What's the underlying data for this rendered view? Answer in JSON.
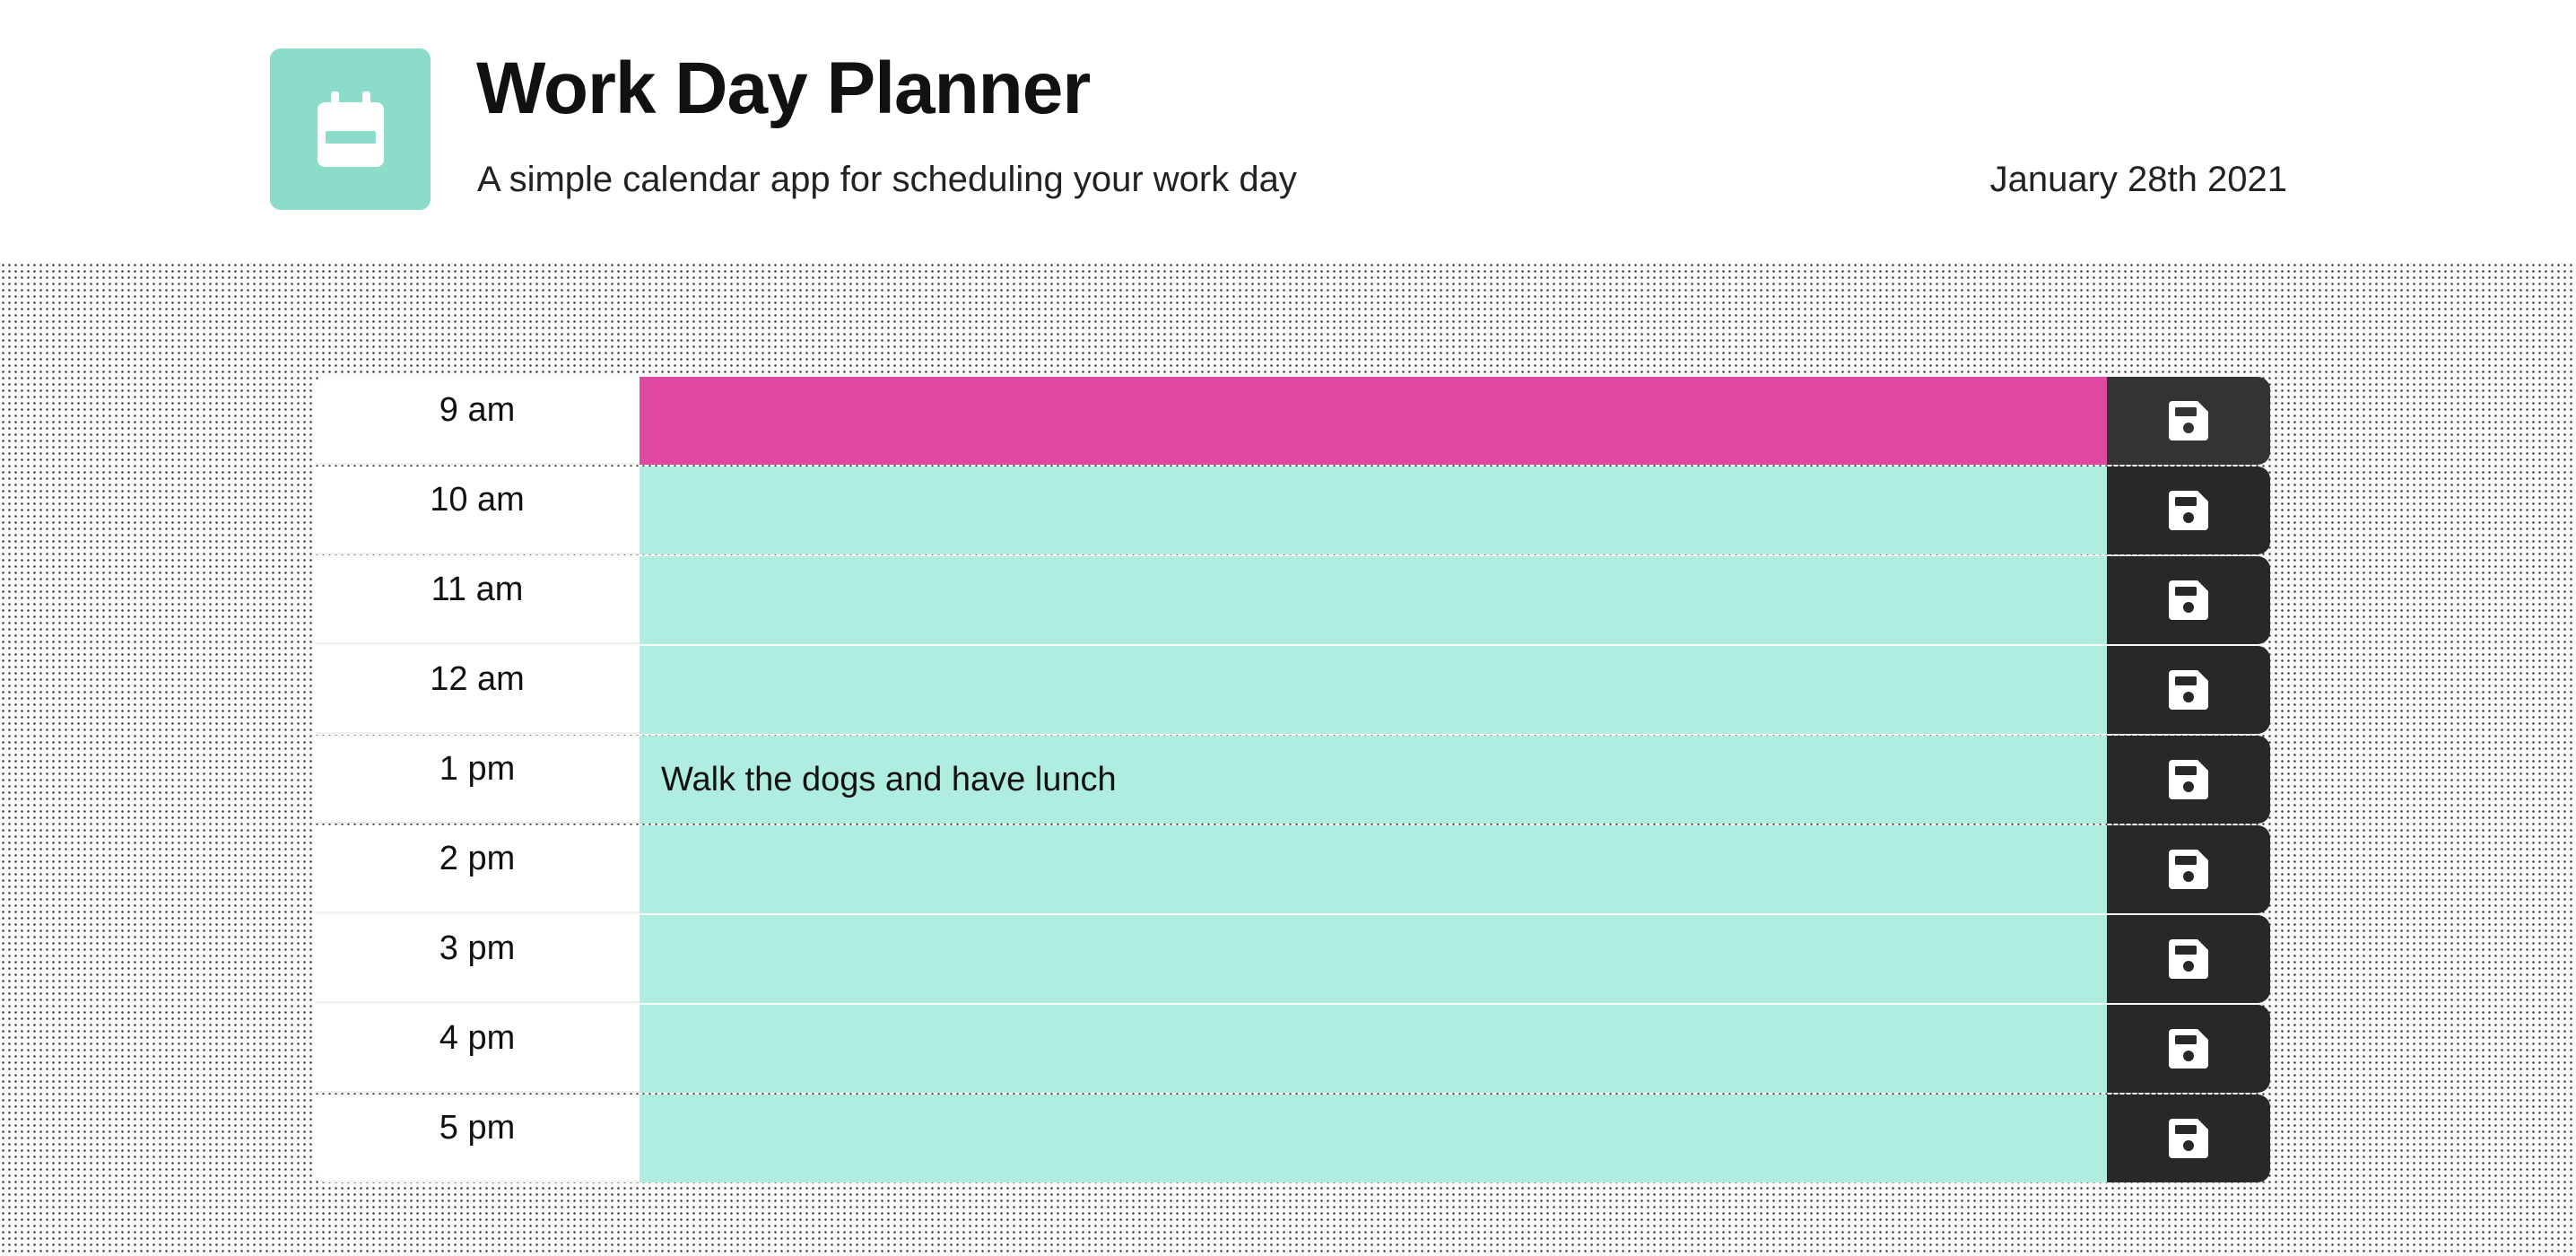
{
  "header": {
    "title": "Work Day Planner",
    "subtitle": "A simple calendar app for scheduling your work day",
    "date": "January 28th 2021",
    "logo_icon": "calendar-icon"
  },
  "colors": {
    "logo": "#8bdcc8",
    "present": "#df48a2",
    "future": "#aeede0",
    "save_button": "#282828",
    "save_button_active": "#333333",
    "save_icon": "#ffffff"
  },
  "save_icon": "floppy-disk-icon",
  "rows": [
    {
      "hour": "9 am",
      "text": "",
      "state": "present"
    },
    {
      "hour": "10 am",
      "text": "",
      "state": "future"
    },
    {
      "hour": "11 am",
      "text": "",
      "state": "future"
    },
    {
      "hour": "12 am",
      "text": "",
      "state": "future"
    },
    {
      "hour": "1 pm",
      "text": "Walk the dogs and have lunch",
      "state": "future"
    },
    {
      "hour": "2 pm",
      "text": "",
      "state": "future"
    },
    {
      "hour": "3 pm",
      "text": "",
      "state": "future"
    },
    {
      "hour": "4 pm",
      "text": "",
      "state": "future"
    },
    {
      "hour": "5 pm",
      "text": "",
      "state": "future"
    }
  ]
}
